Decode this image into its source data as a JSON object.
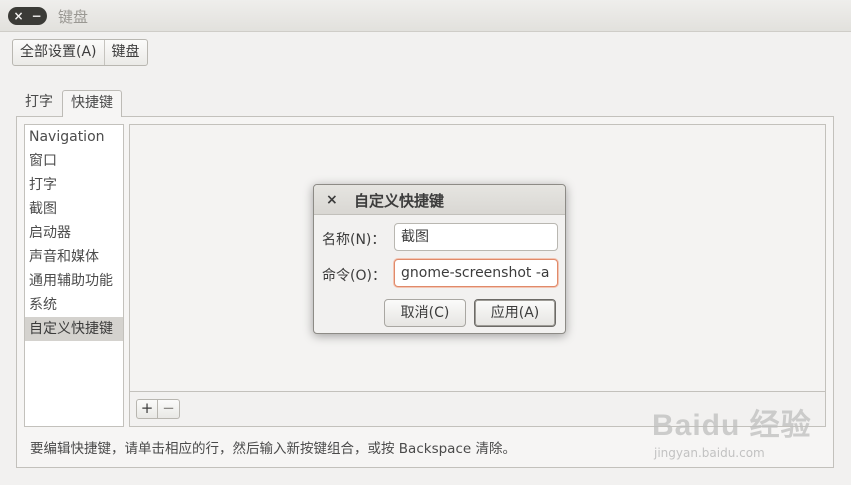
{
  "window": {
    "title": "键盘"
  },
  "titlebar_buttons": {
    "close_icon": "×",
    "minimize_icon": "−"
  },
  "breadcrumb": {
    "items": [
      "全部设置(A)",
      "键盘"
    ]
  },
  "tabs": [
    {
      "label": "打字",
      "active": false
    },
    {
      "label": "快捷键",
      "active": true
    }
  ],
  "categories": [
    {
      "label": "Navigation",
      "selected": false
    },
    {
      "label": "窗口",
      "selected": false
    },
    {
      "label": "打字",
      "selected": false
    },
    {
      "label": "截图",
      "selected": false
    },
    {
      "label": "启动器",
      "selected": false
    },
    {
      "label": "声音和媒体",
      "selected": false
    },
    {
      "label": "通用辅助功能",
      "selected": false
    },
    {
      "label": "系统",
      "selected": false
    },
    {
      "label": "自定义快捷键",
      "selected": true
    }
  ],
  "toolbar": {
    "add_label": "+",
    "remove_label": "−"
  },
  "hint": "要编辑快捷键，请单击相应的行，然后输入新按键组合，或按 Backspace 清除。",
  "dialog": {
    "close_icon": "×",
    "title": "自定义快捷键",
    "name_label": "名称(N)：",
    "name_value": "截图",
    "command_label": "命令(O)：",
    "command_value": "gnome-screenshot -a",
    "cancel_label": "取消(C)",
    "apply_label": "应用(A)"
  },
  "watermark": {
    "logo": "Baidu 经验",
    "url": "jingyan.baidu.com"
  }
}
